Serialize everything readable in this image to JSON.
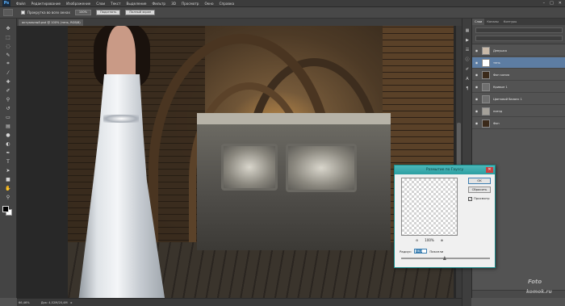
{
  "app": {
    "logo": "Ps"
  },
  "menu": [
    "Файл",
    "Редактирование",
    "Изображение",
    "Слои",
    "Текст",
    "Выделение",
    "Фильтр",
    "3D",
    "Просмотр",
    "Окно",
    "Справка"
  ],
  "window_controls": [
    "–",
    "□",
    "✕"
  ],
  "options_bar": {
    "scroll_all_label": "Прокрутка во всех окнах",
    "btn_100": "100%",
    "btn_fit": "Подогнать",
    "btn_fill": "Полный экран"
  },
  "document_tab": "актуальный.psd @ 100% (тень, RGB/8)",
  "status": {
    "zoom": "66,46%",
    "doc": "Док: 4,52М/20,4М",
    "arrow": "▸"
  },
  "layers_panel": {
    "tabs": [
      "Слои",
      "Каналы",
      "Контуры"
    ],
    "layers": [
      {
        "name": "Девушка",
        "thumb": "#c9b9a8",
        "selected": false,
        "visible": true
      },
      {
        "name": "тень",
        "thumb": "#ffffff",
        "selected": true,
        "visible": true
      },
      {
        "name": "Фон копия",
        "thumb": "#3b2a1a",
        "selected": false,
        "visible": true
      },
      {
        "name": "Кривые 1",
        "thumb": "#6f6f6f",
        "selected": false,
        "visible": true
      },
      {
        "name": "Цветовой баланс 1",
        "thumb": "#6f6f6f",
        "selected": false,
        "visible": true
      },
      {
        "name": "поезд",
        "thumb": "#a5a19a",
        "selected": false,
        "visible": true
      },
      {
        "name": "Фон",
        "thumb": "#3b2a1a",
        "selected": false,
        "visible": true
      }
    ]
  },
  "dialog": {
    "title": "Размытие по Гауссу",
    "close": "✕",
    "ok": "OK",
    "reset": "Сбросить",
    "preview_label": "Просмотр",
    "preview_checked": "✓",
    "zoom_out": "⊖",
    "zoom_value": "100%",
    "zoom_in": "⊕",
    "radius_label": "Радиус:",
    "radius_value": "56,3",
    "radius_unit": "Пиксели",
    "radius_slider_fraction": 0.49
  },
  "watermark": {
    "line1": "Foto",
    "line2": "komok.ru"
  },
  "icons": {
    "tools": [
      "move-icon",
      "marquee-icon",
      "lasso-icon",
      "quick-select-icon",
      "crop-icon",
      "eyedropper-icon",
      "healing-icon",
      "brush-icon",
      "stamp-icon",
      "history-brush-icon",
      "eraser-icon",
      "gradient-icon",
      "blur-icon",
      "dodge-icon",
      "pen-icon",
      "text-icon",
      "path-select-icon",
      "shape-icon",
      "hand-icon",
      "zoom-icon"
    ]
  }
}
